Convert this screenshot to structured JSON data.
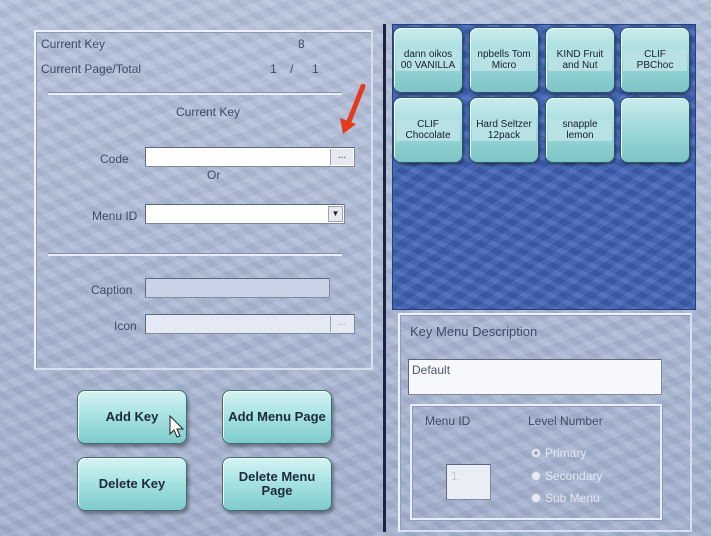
{
  "left": {
    "current_key_label": "Current Key",
    "current_key_value": "8",
    "current_page_label": "Current Page/Total",
    "current_page": "1",
    "page_sep": "/",
    "total_pages": "1",
    "section_title": "Current Key",
    "code_label": "Code",
    "code_value": "",
    "ellipsis": "...",
    "or_label": "Or",
    "menu_id_label": "Menu ID",
    "menu_id_value": "",
    "caption_label": "Caption",
    "caption_value": "",
    "icon_label": "Icon",
    "icon_value": "",
    "icon_button": "..."
  },
  "buttons": {
    "add_key": "Add Key",
    "add_menu_page": "Add Menu Page",
    "delete_key": "Delete Key",
    "delete_menu_page": "Delete Menu Page"
  },
  "keys": [
    {
      "line1": "dann oikos",
      "line2": "00 VANILLA"
    },
    {
      "line1": "npbells Tom",
      "line2": "Micro"
    },
    {
      "line1": "KIND Fruit",
      "line2": "and Nut"
    },
    {
      "line1": "CLIF",
      "line2": "PBChoc"
    },
    {
      "line1": "CLIF",
      "line2": "Chocolate"
    },
    {
      "line1": "Hard Seltzer",
      "line2": "12pack"
    },
    {
      "line1": "snapple",
      "line2": "lemon"
    },
    {
      "line1": "",
      "line2": ""
    }
  ],
  "desc": {
    "title": "Key Menu Description",
    "value": "Default",
    "menu_id_label": "Menu ID",
    "menu_id_value": "1",
    "level_label": "Level Number",
    "levels": [
      "Primary",
      "Secondary",
      "Sub Menu"
    ],
    "selected_level": "Primary"
  },
  "colors": {
    "background": "#aab8d4",
    "menu_area": "#3f62b6",
    "key_button": "#96d4d6",
    "annotation_arrow": "#e63a1e"
  }
}
